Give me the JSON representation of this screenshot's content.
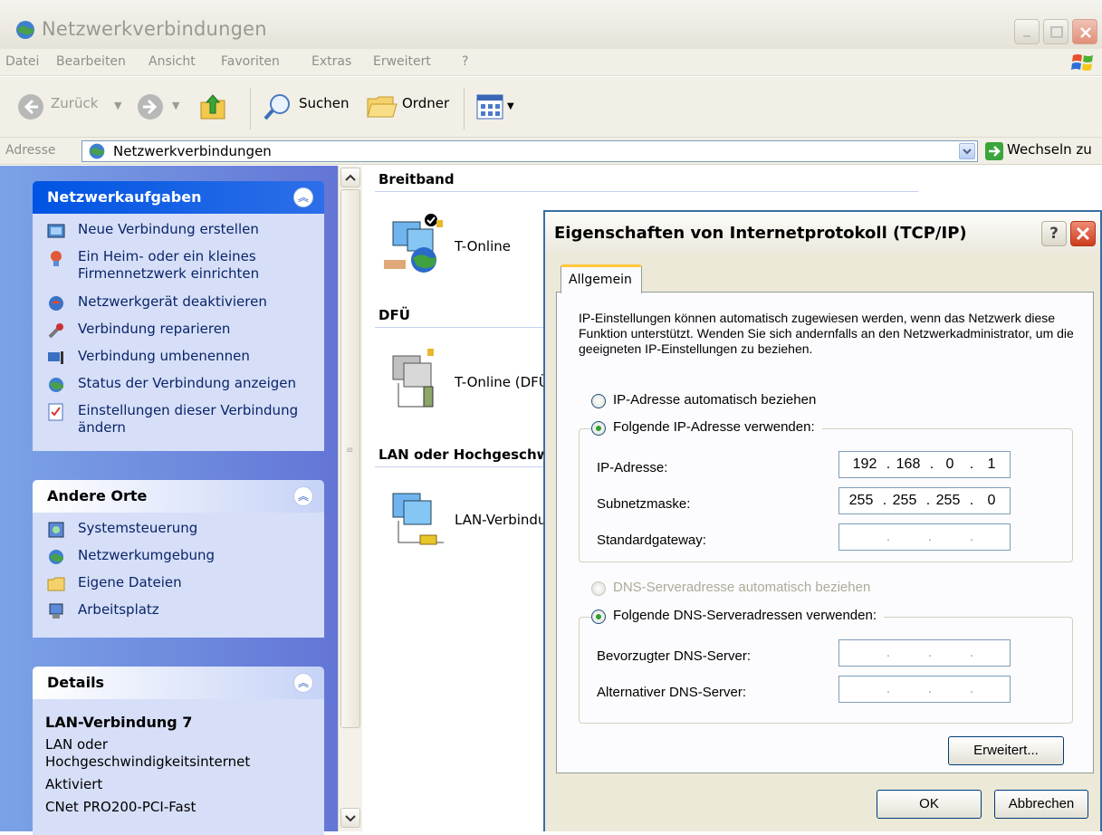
{
  "window": {
    "title": "Netzwerkverbindungen",
    "icon": "network-connections-icon"
  },
  "menu": [
    "Datei",
    "Bearbeiten",
    "Ansicht",
    "Favoriten",
    "Extras",
    "Erweitert",
    "?"
  ],
  "toolbar": {
    "back_label": "Zurück",
    "search_label": "Suchen",
    "folders_label": "Ordner"
  },
  "address": {
    "label": "Adresse",
    "value": "Netzwerkverbindungen",
    "go_label": "Wechseln zu"
  },
  "taskpane": {
    "network_tasks": {
      "title": "Netzwerkaufgaben",
      "items": [
        {
          "label": "Neue Verbindung erstellen",
          "icon": "new-connection-icon"
        },
        {
          "label": "Ein Heim- oder ein kleines Firmennetzwerk einrichten",
          "icon": "home-network-icon"
        },
        {
          "label": "Netzwerkgerät deaktivieren",
          "icon": "disable-device-icon"
        },
        {
          "label": "Verbindung reparieren",
          "icon": "repair-icon"
        },
        {
          "label": "Verbindung umbenennen",
          "icon": "rename-icon"
        },
        {
          "label": "Status der Verbindung anzeigen",
          "icon": "status-icon"
        },
        {
          "label": "Einstellungen dieser Verbindung ändern",
          "icon": "settings-icon"
        }
      ]
    },
    "other_places": {
      "title": "Andere Orte",
      "items": [
        {
          "label": "Systemsteuerung",
          "icon": "control-panel-icon"
        },
        {
          "label": "Netzwerkumgebung",
          "icon": "network-places-icon"
        },
        {
          "label": "Eigene Dateien",
          "icon": "my-documents-icon"
        },
        {
          "label": "Arbeitsplatz",
          "icon": "my-computer-icon"
        }
      ]
    },
    "details": {
      "title": "Details",
      "name": "LAN-Verbindung 7",
      "type": "LAN oder Hochgeschwindigkeitsinternet",
      "status": "Aktiviert",
      "device": "CNet PRO200-PCI-Fast"
    }
  },
  "content": {
    "groups": [
      {
        "title": "Breitband",
        "connection": "T-Online"
      },
      {
        "title": "DFÜ",
        "connection": "T-Online (DFÜ"
      },
      {
        "title": "LAN oder Hochgeschw",
        "connection": "LAN-Verbindu"
      }
    ]
  },
  "dialog": {
    "title": "Eigenschaften von Internetprotokoll (TCP/IP)",
    "help_label": "?",
    "tab_label": "Allgemein",
    "intro": "IP-Einstellungen können automatisch zugewiesen werden, wenn das Netzwerk diese Funktion unterstützt. Wenden Sie sich andernfalls an den Netzwerkadministrator, um die geeigneten IP-Einstellungen zu beziehen.",
    "ip_auto_label": "IP-Adresse automatisch beziehen",
    "ip_manual_label": "Folgende IP-Adresse verwenden:",
    "ip_label": "IP-Adresse:",
    "ip_value": [
      "192",
      "168",
      "0",
      "1"
    ],
    "subnet_label": "Subnetzmaske:",
    "subnet_value": [
      "255",
      "255",
      "255",
      "0"
    ],
    "gateway_label": "Standardgateway:",
    "dns_auto_label": "DNS-Serveradresse automatisch beziehen",
    "dns_manual_label": "Folgende DNS-Serveradressen verwenden:",
    "dns_pref_label": "Bevorzugter DNS-Server:",
    "dns_alt_label": "Alternativer DNS-Server:",
    "advanced_label": "Erweitert...",
    "ok_label": "OK",
    "cancel_label": "Abbrechen",
    "selected_ip_mode": "manual",
    "selected_dns_mode": "manual"
  },
  "colors": {
    "xp_blue": "#0054e3",
    "taskpane_gradient_start": "#7ba2e7",
    "taskpane_gradient_end": "#6375d6",
    "dialog_face": "#ece9d8",
    "close_red": "#cd3b1d"
  }
}
